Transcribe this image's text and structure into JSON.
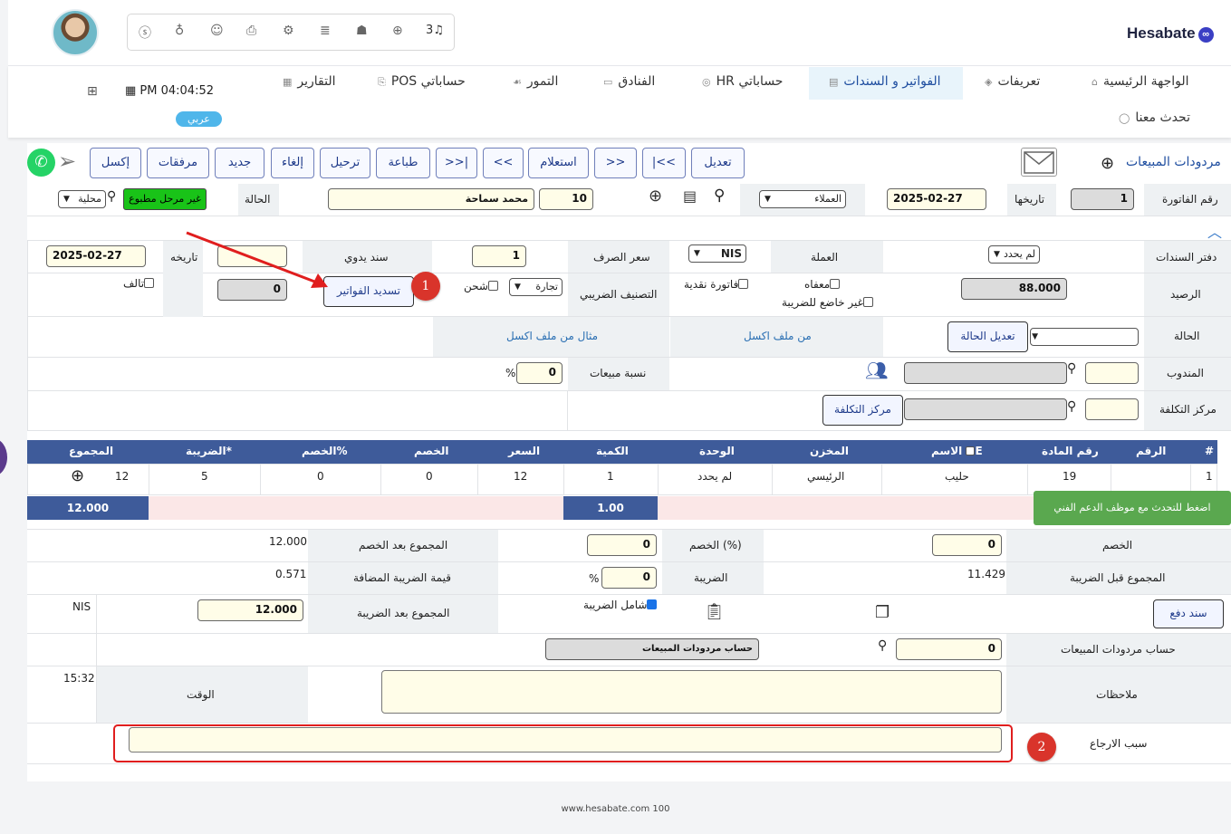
{
  "app": {
    "logo": "Hesabate",
    "language_badge": "عربي",
    "clock": "PM 04:04:52",
    "notif_count": "3"
  },
  "topbar_icons": [
    "dollar-circle-icon",
    "money-bag-icon",
    "users-group-icon",
    "printer-icon",
    "gears-icon",
    "database-icon",
    "android-icon",
    "plus-circle-icon",
    "bell-icon"
  ],
  "nav": {
    "items": [
      "الواجهة الرئيسية",
      "تعريفات",
      "الفواتير و السندات",
      "حساباتي HR",
      "الفنادق",
      "التمور",
      "حساباتي POS",
      "التقارير"
    ],
    "chat": "تحدث معنا"
  },
  "page": {
    "title": "مردودات المبيعات"
  },
  "toolbar": {
    "buttons": [
      "تعديل",
      "|<<",
      ">>",
      "استعلام",
      "<<",
      ">>|",
      "طباعة",
      "ترحيل",
      "إلغاء",
      "جديد",
      "مرفقات",
      "إكسل"
    ]
  },
  "header_row": {
    "invoice_no_label": "رقم الفاتورة",
    "invoice_no": "1",
    "date_label": "تاريخها",
    "date": "2025-02-27",
    "customer_type": "العملاء",
    "customer_code": "10",
    "customer_name": "محمد سماحة",
    "status_label": "الحالة",
    "status_value": "غير مرحل مطبوع",
    "locality": "محلية"
  },
  "form": {
    "book_label": "دفتر السندات",
    "book_value": "لم يحدد",
    "currency_label": "العملة",
    "currency_value": "NIS",
    "rate_label": "سعر الصرف",
    "rate_value": "1",
    "manual_label": "سند يدوي",
    "manual_value": "",
    "manual_date_label": "تاريخه",
    "manual_date": "2025-02-27",
    "balance_label": "الرصيد",
    "balance_value": "88.000",
    "exempt_label": "معفاه",
    "not_taxable_label": "غير خاضع للضريبة",
    "cash_invoice_label": "فاتورة نقدية",
    "tax_class_label": "التصنيف الضريبي",
    "tax_class_value": "تجارة",
    "shipping_label": "شحن",
    "settle_button": "تسديد الفواتير",
    "settle_value": "0",
    "damaged_label": "تالف",
    "state_label": "الحالة",
    "edit_state_button": "تعديل الحالة",
    "excel_link": "من ملف اكسل",
    "excel_sample_link": "مثال من ملف اكسل",
    "rep_label": "المندوب",
    "sales_pct_label": "نسبة مبيعات",
    "sales_pct_value": "0",
    "pct_sign": "%",
    "cost_center_label": "مركز التكلفة",
    "cost_center_button": "مركز التكلفة"
  },
  "table": {
    "headers": [
      "#",
      "الرقم",
      "رقم المادة",
      "الاسم",
      "المخزن",
      "الوحدة",
      "الكمية",
      "السعر",
      "الخصم",
      "الخصم%",
      "الضريبة*",
      "المجموع"
    ],
    "name_header_suffix": "E",
    "rows": [
      {
        "idx": "1",
        "num": "",
        "item_no": "19",
        "name": "حليب",
        "store": "الرئيسي",
        "unit": "لم يحدد",
        "qty": "1",
        "price": "12",
        "disc": "0",
        "disc_pct": "0",
        "tax": "5",
        "total": "12"
      }
    ],
    "totals": {
      "qty": "1.00",
      "total": "12.000"
    }
  },
  "support_chip": "اضغط للتحدث مع موظف الدعم الفني",
  "summary": {
    "discount_label": "الخصم",
    "discount_value": "0",
    "disc_pct_label": "الخصم (%)",
    "disc_pct_value": "0",
    "after_disc_label": "المجموع بعد الخصم",
    "after_disc_value": "12.000",
    "before_tax_label": "المجموع قبل الضريبة",
    "before_tax_value": "11.429",
    "tax_label": "الضريبة",
    "tax_value": "0",
    "vat_label": "قيمة الضريبة المضافة",
    "vat_value": "0.571",
    "payment_button": "سند دفع",
    "incl_tax_label": "شامل الضريبة",
    "after_tax_label": "المجموع بعد الضريبة",
    "after_tax_value": "12.000",
    "currency": "NIS",
    "account_label": "حساب مردودات المبيعات",
    "account_code": "0",
    "account_name": "حساب مردودات المبيعات",
    "notes_label": "ملاحظات",
    "time_label": "الوقت",
    "time_value": "15:32",
    "return_reason_label": "سبب الارجاع"
  },
  "annotations": {
    "badge1": "1",
    "badge2": "2"
  },
  "footer": "www.hesabate.com 100",
  "colors": {
    "header_bg": "#3e5b9a",
    "accent_blue": "#1e3a8a",
    "status_green": "#19c318",
    "annotation_red": "#e01e1e",
    "totals_bar": "#3e5b9a",
    "chip_green": "#5aa84f"
  }
}
